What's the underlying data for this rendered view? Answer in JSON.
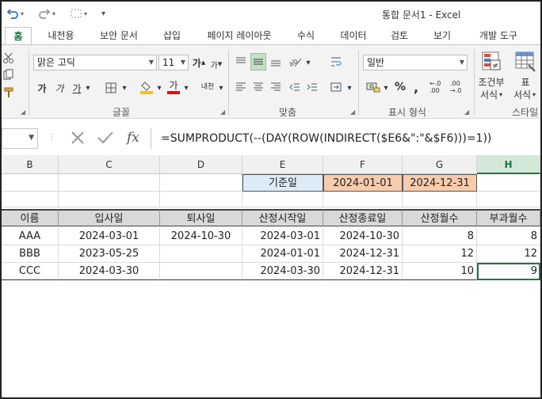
{
  "title": "통합 문서1 - Excel",
  "qat": {
    "undo_icon": "undo-icon",
    "redo_icon": "redo-icon",
    "customize_icon": "customize-icon",
    "more_label": "▾"
  },
  "tabs": [
    {
      "label": "홈",
      "active": true
    },
    {
      "label": "내전용",
      "active": false
    },
    {
      "label": "보안 문서",
      "active": false
    },
    {
      "label": "삽입",
      "active": false
    },
    {
      "label": "페이지 레이아웃",
      "active": false
    },
    {
      "label": "수식",
      "active": false
    },
    {
      "label": "데이터",
      "active": false
    },
    {
      "label": "검토",
      "active": false
    },
    {
      "label": "보기",
      "active": false
    },
    {
      "label": "개발 도구",
      "active": false
    }
  ],
  "ribbon": {
    "font_name": "맑은 고딕",
    "font_size": "11",
    "grow_font": "가",
    "shrink_font": "가",
    "bold": "가",
    "italic": "가",
    "underline": "가",
    "font_color_label": "가",
    "phonetic_label": "내천",
    "number_format": "일반",
    "percent": "%",
    "comma": ",",
    "dec_increase": "←.0 .00",
    "dec_decrease": ".00 →.0",
    "cond_format_line1": "조건부",
    "cond_format_line2": "서식",
    "table_format_line1": "표",
    "table_format_line2": "서식",
    "styles_label": "스타일",
    "group_font": "글꼴",
    "group_align": "맞춤",
    "group_number": "표시 형식",
    "accent_color": "#217346",
    "fill_color": "#ffc000",
    "font_color": "#ff0000"
  },
  "formula_bar": {
    "name_box": "",
    "cancel_icon": "cancel-icon",
    "enter_icon": "enter-icon",
    "fx_label": "fx",
    "formula": "=SUMPRODUCT(--(DAY(ROW(INDIRECT($E6&\":\"&$F6)))=1))"
  },
  "columns": [
    "B",
    "C",
    "D",
    "E",
    "F",
    "G",
    "H"
  ],
  "selected_column": "H",
  "reference": {
    "label": "기준일",
    "start": "2024-01-01",
    "end": "2024-12-31"
  },
  "table": {
    "headers": [
      "이름",
      "입사일",
      "퇴사일",
      "산정시작일",
      "산정종료일",
      "산정월수",
      "부과월수"
    ],
    "rows": [
      [
        "AAA",
        "2024-03-01",
        "2024-10-30",
        "2024-03-01",
        "2024-10-30",
        "8",
        "8"
      ],
      [
        "BBB",
        "2023-05-25",
        "",
        "2024-01-01",
        "2024-12-31",
        "12",
        "12"
      ],
      [
        "CCC",
        "2024-03-30",
        "",
        "2024-03-30",
        "2024-12-31",
        "10",
        "9"
      ]
    ]
  }
}
